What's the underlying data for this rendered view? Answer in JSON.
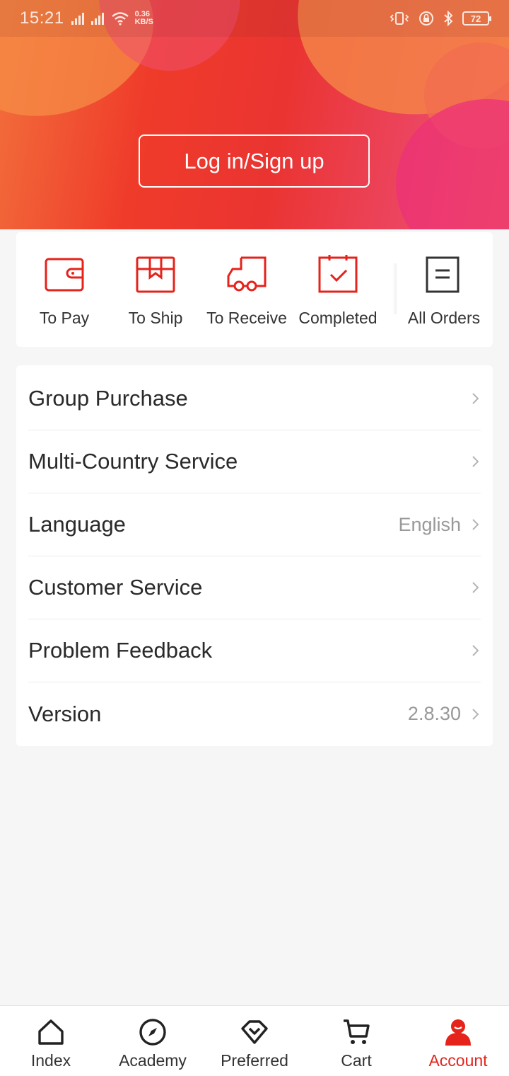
{
  "status_bar": {
    "time": "15:21",
    "net_speed_value": "0.36",
    "net_speed_unit": "KB/S",
    "battery": "72"
  },
  "header": {
    "login_label": "Log in/Sign up"
  },
  "orders": {
    "items": [
      {
        "label": "To Pay",
        "icon": "wallet-icon"
      },
      {
        "label": "To Ship",
        "icon": "package-icon"
      },
      {
        "label": "To Receive",
        "icon": "truck-icon"
      },
      {
        "label": "Completed",
        "icon": "checked-box-icon"
      },
      {
        "label": "All Orders",
        "icon": "order-list-icon"
      }
    ]
  },
  "menu": {
    "items": [
      {
        "label": "Group Purchase",
        "value": ""
      },
      {
        "label": "Multi-Country Service",
        "value": ""
      },
      {
        "label": "Language",
        "value": "English"
      },
      {
        "label": "Customer Service",
        "value": ""
      },
      {
        "label": "Problem Feedback",
        "value": ""
      },
      {
        "label": "Version",
        "value": "2.8.30"
      }
    ]
  },
  "bottom_nav": {
    "items": [
      {
        "label": "Index",
        "icon": "home-icon"
      },
      {
        "label": "Academy",
        "icon": "compass-icon"
      },
      {
        "label": "Preferred",
        "icon": "diamond-icon"
      },
      {
        "label": "Cart",
        "icon": "cart-icon"
      },
      {
        "label": "Account",
        "icon": "user-icon"
      }
    ],
    "active": "Account"
  },
  "colors": {
    "accent": "#e5231b",
    "hero_start": "#f2703c",
    "hero_end": "#ec4560",
    "background": "#f6f6f6"
  }
}
